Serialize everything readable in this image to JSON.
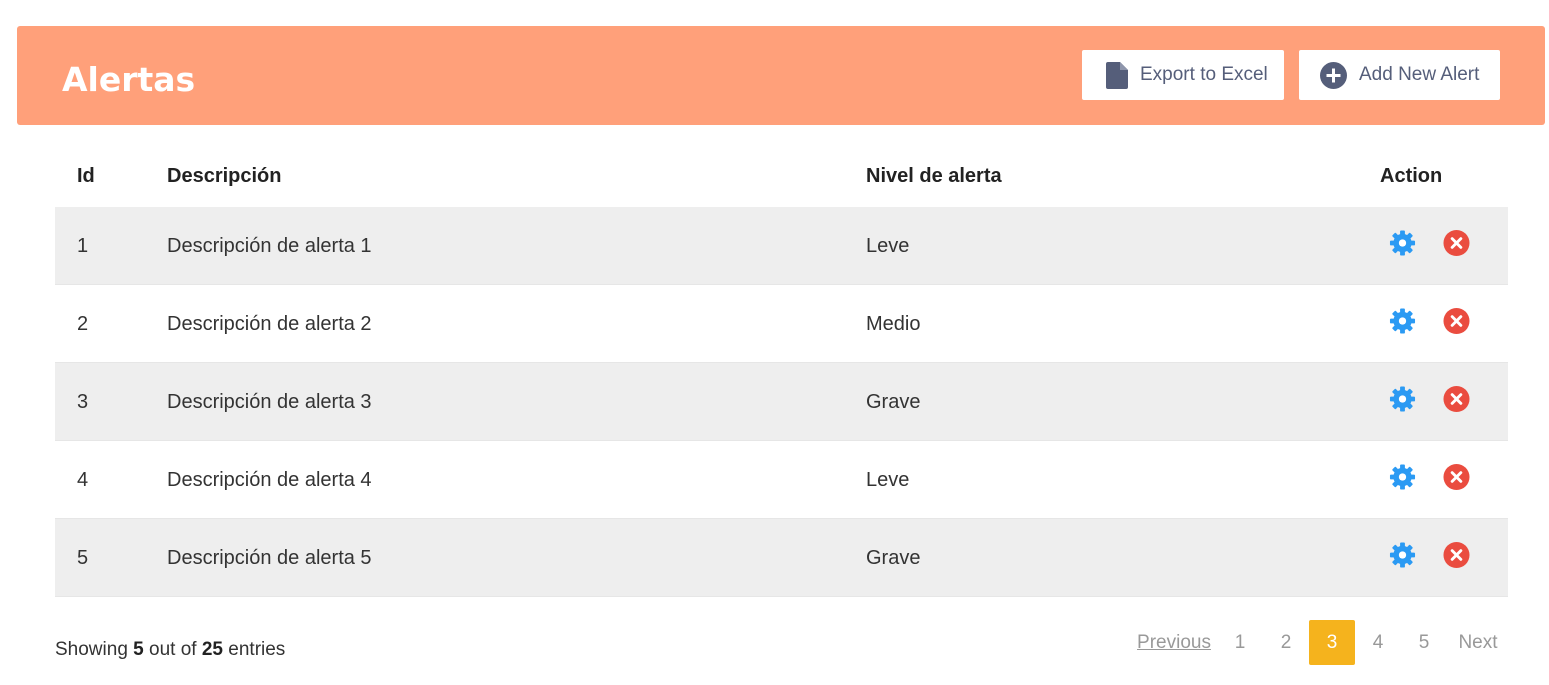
{
  "header": {
    "title": "Alertas",
    "export_label": "Export to Excel",
    "add_label": "Add New Alert",
    "bg_color": "#ffa07a"
  },
  "table": {
    "columns": [
      "Id",
      "Descripción",
      "Nivel de alerta",
      "Action"
    ],
    "rows": [
      {
        "id": "1",
        "desc": "Descripción de alerta 1",
        "level": "Leve"
      },
      {
        "id": "2",
        "desc": "Descripción de alerta 2",
        "level": "Medio"
      },
      {
        "id": "3",
        "desc": "Descripción de alerta 3",
        "level": "Grave"
      },
      {
        "id": "4",
        "desc": "Descripción de alerta 4",
        "level": "Leve"
      },
      {
        "id": "5",
        "desc": "Descripción de alerta 5",
        "level": "Grave"
      }
    ],
    "edit_icon": "gear-icon",
    "delete_icon": "close-circle-icon",
    "edit_color": "#2b9af3",
    "delete_color": "#ea4c3f"
  },
  "footer": {
    "showing_prefix": "Showing",
    "shown": "5",
    "out_of": "out of",
    "total": "25",
    "entries": "entries"
  },
  "pagination": {
    "previous": "Previous",
    "pages": [
      "1",
      "2",
      "3",
      "4",
      "5"
    ],
    "active": "3",
    "next": "Next",
    "active_color": "#f5b31d"
  }
}
